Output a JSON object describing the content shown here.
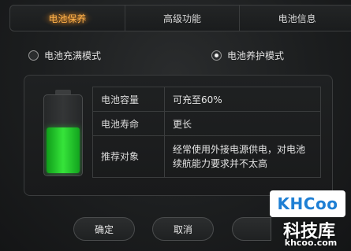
{
  "tabs": [
    {
      "label": "电池保养",
      "active": true
    },
    {
      "label": "高级功能",
      "active": false
    },
    {
      "label": "电池信息",
      "active": false
    }
  ],
  "modes": {
    "full": {
      "label": "电池充满模式",
      "selected": false
    },
    "care": {
      "label": "电池养护模式",
      "selected": true
    }
  },
  "battery": {
    "level_percent": 60,
    "fill_color": "#36e43a"
  },
  "info_rows": [
    {
      "key": "电池容量",
      "value": "可充至60%"
    },
    {
      "key": "电池寿命",
      "value": "更长"
    },
    {
      "key": "推荐对象",
      "value": "经常使用外接电源供电，对电池续航能力要求并不太高"
    }
  ],
  "buttons": {
    "ok": "确定",
    "cancel": "取消"
  },
  "watermark": {
    "logo": "KHCoo",
    "name": "科技库",
    "url": "khcoo.com"
  },
  "colors": {
    "accent": "#ffb14a",
    "background": "#1b1d1e"
  }
}
